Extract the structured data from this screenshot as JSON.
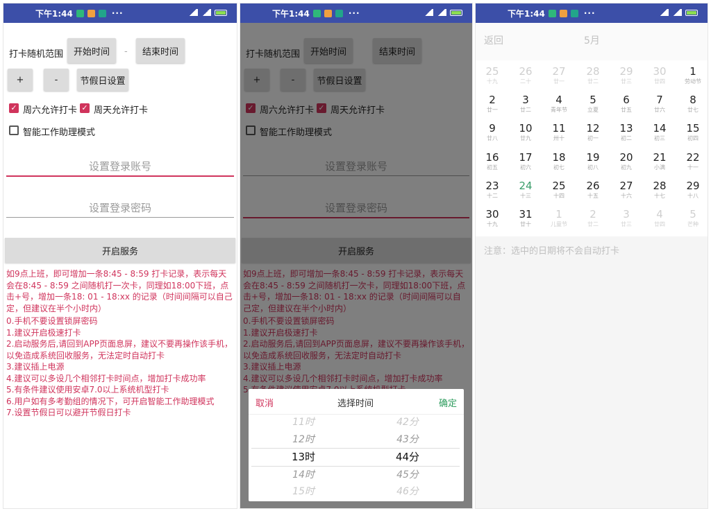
{
  "status": {
    "time": "下午1:44",
    "dots": "···"
  },
  "form": {
    "range_label": "打卡随机范围",
    "start_time": "开始时间",
    "dash": "-",
    "end_time": "结束时间",
    "plus": "+",
    "minus": "-",
    "holiday": "节假日设置",
    "sat_label": "周六允许打卡",
    "sun_label": "周天允许打卡",
    "assist_label": "智能工作助理模式",
    "check_mark": "✓",
    "account_placeholder": "设置登录账号",
    "password_placeholder": "设置登录密码",
    "start_service": "开启服务",
    "desc": "如9点上班，即可增加一条8:45 - 8:59 打卡记录，表示每天会在8:45 - 8:59 之间随机打一次卡，同理如18:00下班，点击+号，增加一条18: 01 - 18:xx 的记录（时间间隔可以自己定，但建议在半个小时内）",
    "tips": [
      "0.手机不要设置锁屏密码",
      "1.建议开启极速打卡",
      "2.启动服务后,请回到APP页面息屏，建议不要再操作该手机，",
      "以免造成系统回收服务，无法定时自动打卡",
      "3.建议插上电源",
      "4.建议可以多设几个相邻打卡时间点，增加打卡成功率",
      "5.有条件建议使用安卓7.0以上系统机型打卡",
      "6.用户如有多考勤组的情况下，可开启智能工作助理模式",
      "7.设置节假日可以避开节假日打卡"
    ]
  },
  "picker": {
    "cancel": "取消",
    "title": "选择时间",
    "confirm": "确定",
    "hours": [
      "11时",
      "12时",
      "13时",
      "14时",
      "15时"
    ],
    "minutes": [
      "42分",
      "43分",
      "44分",
      "45分",
      "46分"
    ],
    "selected_index": 2
  },
  "calendar": {
    "back": "返回",
    "month": "5月",
    "note": "注意：选中的日期将不会自动打卡",
    "today_color": "#3a9d6a",
    "days": [
      {
        "d": "25",
        "l": "十九",
        "dim": true
      },
      {
        "d": "26",
        "l": "二十",
        "dim": true
      },
      {
        "d": "27",
        "l": "廿一",
        "dim": true
      },
      {
        "d": "28",
        "l": "廿二",
        "dim": true
      },
      {
        "d": "29",
        "l": "廿三",
        "dim": true
      },
      {
        "d": "30",
        "l": "廿四",
        "dim": true
      },
      {
        "d": "1",
        "l": "劳动节"
      },
      {
        "d": "2",
        "l": "廿一"
      },
      {
        "d": "3",
        "l": "廿二"
      },
      {
        "d": "4",
        "l": "青年节"
      },
      {
        "d": "5",
        "l": "立夏"
      },
      {
        "d": "6",
        "l": "廿五"
      },
      {
        "d": "7",
        "l": "廿六"
      },
      {
        "d": "8",
        "l": "廿七"
      },
      {
        "d": "9",
        "l": "廿八"
      },
      {
        "d": "10",
        "l": "廿九"
      },
      {
        "d": "11",
        "l": "卅十"
      },
      {
        "d": "12",
        "l": "初一"
      },
      {
        "d": "13",
        "l": "初二"
      },
      {
        "d": "14",
        "l": "初三"
      },
      {
        "d": "15",
        "l": "初四"
      },
      {
        "d": "16",
        "l": "初五"
      },
      {
        "d": "17",
        "l": "初六"
      },
      {
        "d": "18",
        "l": "初七"
      },
      {
        "d": "19",
        "l": "初八"
      },
      {
        "d": "20",
        "l": "初九"
      },
      {
        "d": "21",
        "l": "小满"
      },
      {
        "d": "22",
        "l": "十一"
      },
      {
        "d": "23",
        "l": "十二"
      },
      {
        "d": "24",
        "l": "十三",
        "today": true
      },
      {
        "d": "25",
        "l": "十四"
      },
      {
        "d": "26",
        "l": "十五"
      },
      {
        "d": "27",
        "l": "十六"
      },
      {
        "d": "28",
        "l": "十七"
      },
      {
        "d": "29",
        "l": "十八"
      },
      {
        "d": "30",
        "l": "十九"
      },
      {
        "d": "31",
        "l": "廿十"
      },
      {
        "d": "1",
        "l": "儿童节",
        "dim": true
      },
      {
        "d": "2",
        "l": "廿二",
        "dim": true
      },
      {
        "d": "3",
        "l": "廿三",
        "dim": true
      },
      {
        "d": "4",
        "l": "廿四",
        "dim": true
      },
      {
        "d": "5",
        "l": "芒种",
        "dim": true
      }
    ]
  },
  "colors": {
    "accent": "#d0345c",
    "statusbar": "#3c4fa8",
    "today": "#3a9d6a"
  }
}
